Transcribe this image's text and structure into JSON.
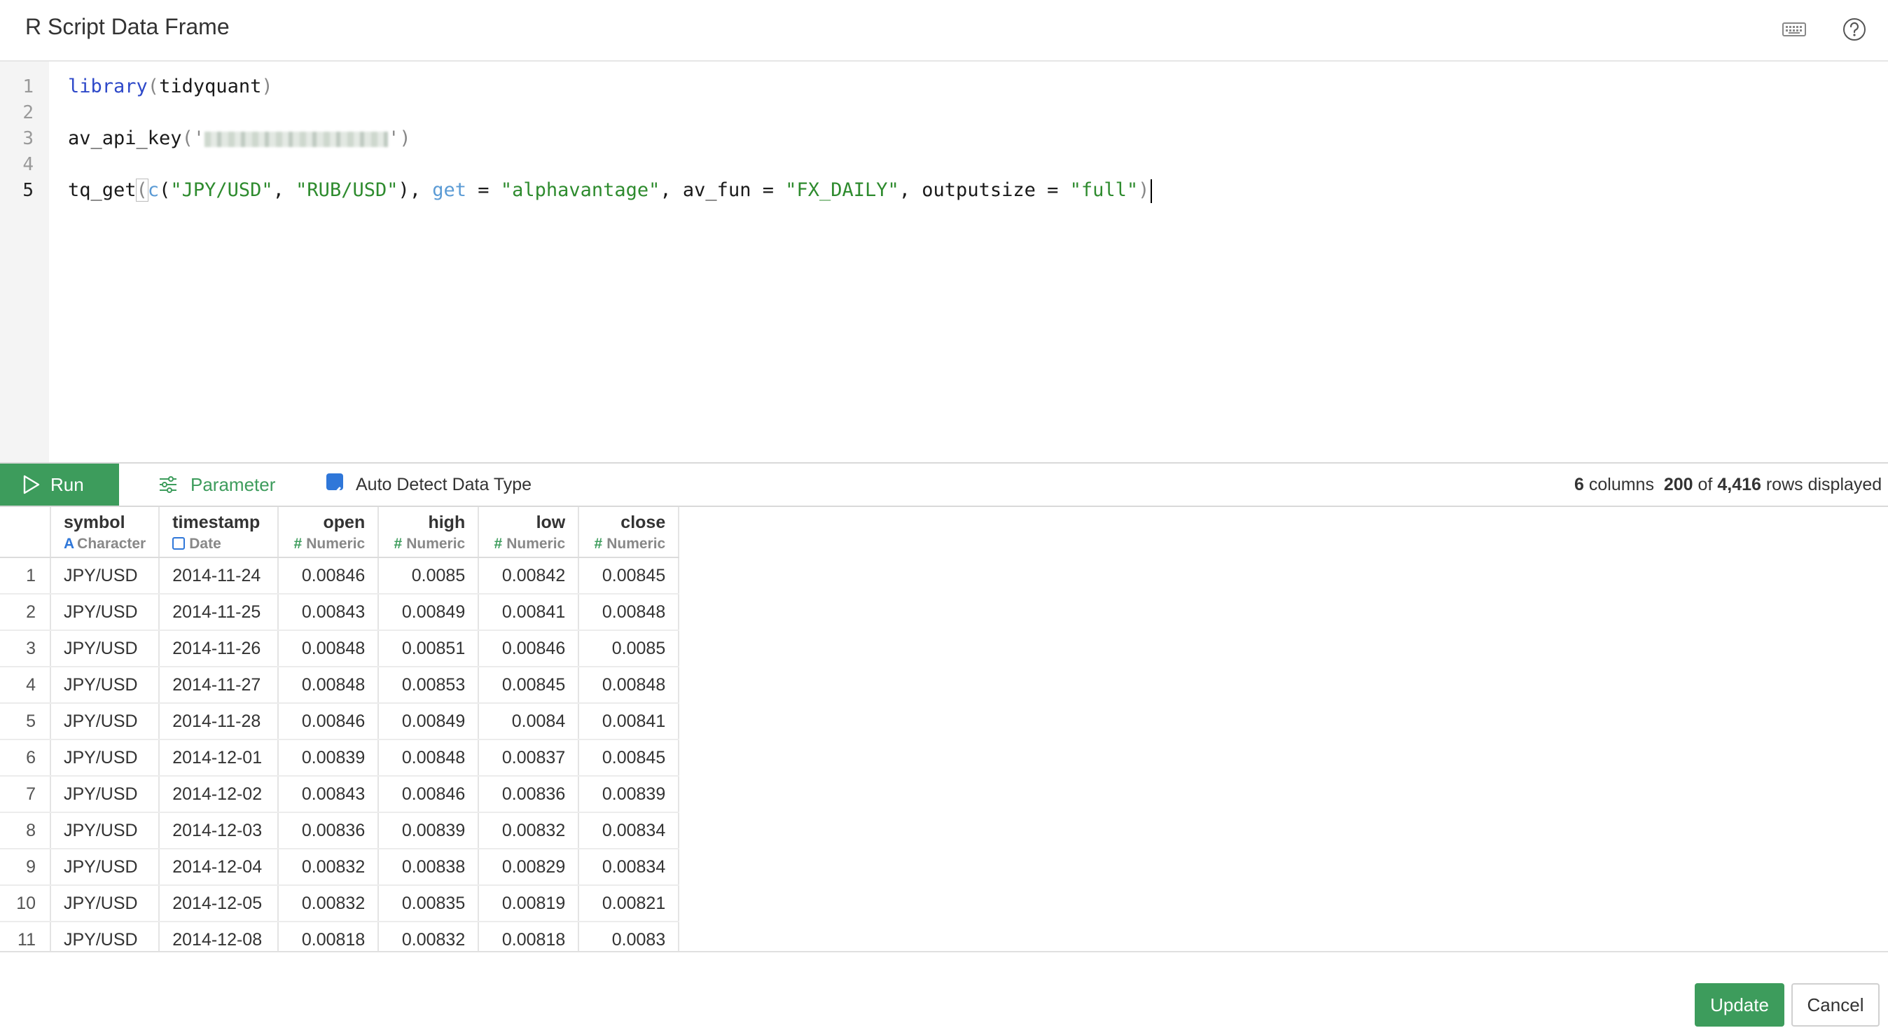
{
  "header": {
    "title": "R Script Data Frame",
    "keyboard_icon": "keyboard-icon",
    "help_icon": "help-circle-icon"
  },
  "editor": {
    "line_numbers": [
      "1",
      "2",
      "3",
      "4",
      "5"
    ],
    "line1": {
      "fn": "library",
      "open": "(",
      "arg": "tidyquant",
      "close": ")"
    },
    "line3": {
      "fn": "av_api_key",
      "open": "('",
      "close": "')"
    },
    "line5": {
      "fn": "tq_get",
      "open": "(",
      "c_fn": "c",
      "c_open": "(",
      "s1": "\"JPY/USD\"",
      "comma1": ", ",
      "s2": "\"RUB/USD\"",
      "c_close": "), ",
      "get_kw": "get",
      "eq1": " = ",
      "s3": "\"alphavantage\"",
      "mid1": ", av_fun = ",
      "s4": "\"FX_DAILY\"",
      "mid2": ", outputsize = ",
      "s5": "\"full\"",
      "close": ")"
    }
  },
  "toolbar": {
    "run_label": "Run",
    "parameter_label": "Parameter",
    "auto_detect_label": "Auto Detect Data Type",
    "auto_detect_checked": true,
    "columns_count": "6",
    "columns_label": "columns",
    "rows_shown": "200",
    "of_label": "of",
    "rows_total": "4,416",
    "rows_label": "rows displayed"
  },
  "table": {
    "columns": [
      {
        "name": "symbol",
        "type": "Character"
      },
      {
        "name": "timestamp",
        "type": "Date"
      },
      {
        "name": "open",
        "type": "Numeric"
      },
      {
        "name": "high",
        "type": "Numeric"
      },
      {
        "name": "low",
        "type": "Numeric"
      },
      {
        "name": "close",
        "type": "Numeric"
      }
    ],
    "rows": [
      [
        "1",
        "JPY/USD",
        "2014-11-24",
        "0.00846",
        "0.0085",
        "0.00842",
        "0.00845"
      ],
      [
        "2",
        "JPY/USD",
        "2014-11-25",
        "0.00843",
        "0.00849",
        "0.00841",
        "0.00848"
      ],
      [
        "3",
        "JPY/USD",
        "2014-11-26",
        "0.00848",
        "0.00851",
        "0.00846",
        "0.0085"
      ],
      [
        "4",
        "JPY/USD",
        "2014-11-27",
        "0.00848",
        "0.00853",
        "0.00845",
        "0.00848"
      ],
      [
        "5",
        "JPY/USD",
        "2014-11-28",
        "0.00846",
        "0.00849",
        "0.0084",
        "0.00841"
      ],
      [
        "6",
        "JPY/USD",
        "2014-12-01",
        "0.00839",
        "0.00848",
        "0.00837",
        "0.00845"
      ],
      [
        "7",
        "JPY/USD",
        "2014-12-02",
        "0.00843",
        "0.00846",
        "0.00836",
        "0.00839"
      ],
      [
        "8",
        "JPY/USD",
        "2014-12-03",
        "0.00836",
        "0.00839",
        "0.00832",
        "0.00834"
      ],
      [
        "9",
        "JPY/USD",
        "2014-12-04",
        "0.00832",
        "0.00838",
        "0.00829",
        "0.00834"
      ],
      [
        "10",
        "JPY/USD",
        "2014-12-05",
        "0.00832",
        "0.00835",
        "0.00819",
        "0.00821"
      ],
      [
        "11",
        "JPY/USD",
        "2014-12-08",
        "0.00818",
        "0.00832",
        "0.00818",
        "0.0083"
      ]
    ]
  },
  "footer": {
    "update_label": "Update",
    "cancel_label": "Cancel"
  },
  "colors": {
    "accent_green": "#3d9c5c",
    "accent_blue": "#2f77d9"
  }
}
